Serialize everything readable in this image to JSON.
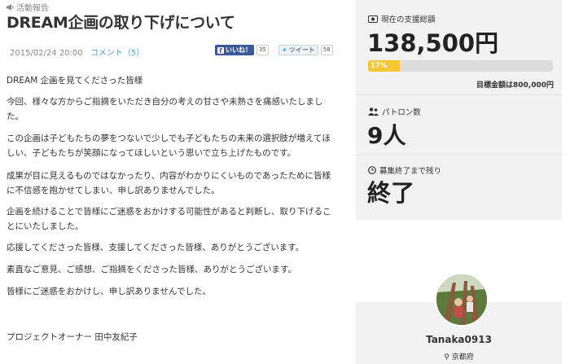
{
  "article": {
    "category": "活動報告",
    "title": "DREAM企画の取り下げについて",
    "date": "2015/02/24 20:00",
    "comment_link": "コメント（5）",
    "like_label": "いいね！",
    "like_count": "35",
    "tweet_label": "ツイート",
    "tweet_count": "58",
    "paragraphs": [
      "DREAM 企画を見てくださった皆様",
      "今回、様々な方からご指摘をいただき自分の考えの甘さや未熟さを痛感いたしました。",
      "この企画は子どもたちの夢をつないで少しでも子どもたちの未来の選択肢が増えてほしい、子どもたちが笑顔になってほしいという思いで立ち上げたものです。",
      "成果が目に見えるものではなかったり、内容がわかりにくいものであったために皆様に不信感を抱かせてしまい、申し訳ありませんでした。",
      "企画を続けることで皆様にご迷惑をおかけする可能性があると判断し、取り下げることにいたしました。",
      "応援してくださった皆様、支援してくださった皆様、ありがとうございます。",
      "素直なご意見、ご感想、ご指摘をくださった皆様、ありがとうございます。",
      "皆様にご迷惑をおかけし、申し訳ありませんでした。",
      "プロジェクトオーナー 田中友紀子"
    ]
  },
  "stats": {
    "funding_label": "現在の支援総額",
    "funding_amount": "138,500円",
    "progress_percent": 17,
    "progress_text": "17%",
    "target_text": "目標金額は800,000円",
    "patrons_label": "パトロン数",
    "patrons_count": "9人",
    "remaining_label": "募集終了まで残り",
    "remaining_value": "終了"
  },
  "owner": {
    "username": "Tanaka0913",
    "location": "京都府"
  },
  "colors": {
    "progress_fill": "#f7c633",
    "link": "#4aa3c8",
    "facebook": "#3b5998"
  }
}
